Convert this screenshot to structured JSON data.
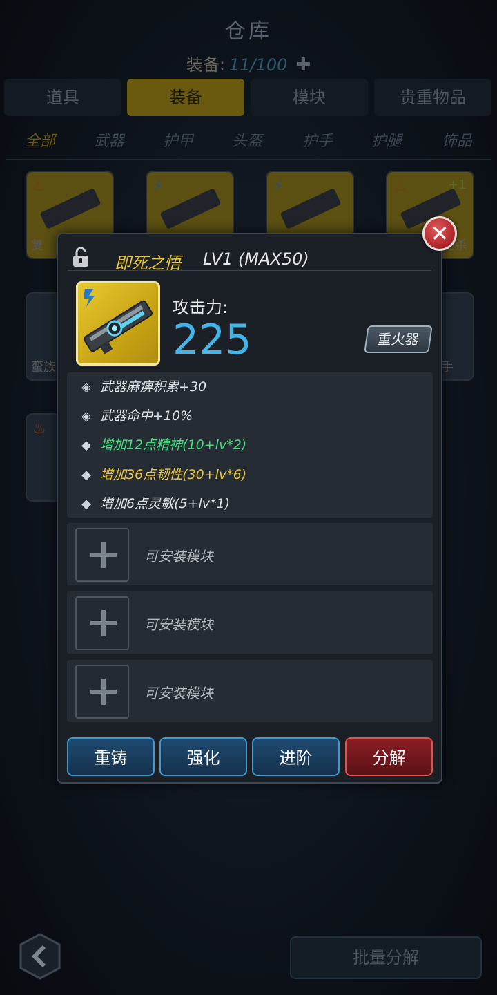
{
  "header": {
    "title": "仓库",
    "count_label": "装备:",
    "count_value": "11/100"
  },
  "tabs": [
    "道具",
    "装备",
    "模块",
    "贵重物品"
  ],
  "active_tab": 1,
  "subtabs": [
    "全部",
    "武器",
    "护甲",
    "头盔",
    "护手",
    "护腿",
    "饰品"
  ],
  "active_subtab": 0,
  "grid_labels": {
    "card1": "复",
    "card4_level": "+1",
    "card4_label": "绝杀",
    "card5": "蛮族",
    "card6": "手"
  },
  "item": {
    "name": "即死之悟",
    "level": "LV1 (MAX50)",
    "attack_label": "攻击力:",
    "attack_value": "225",
    "class": "重火器",
    "stats": [
      {
        "text": "武器麻痹积累+30",
        "style": "base",
        "icon": "target-diamond-icon"
      },
      {
        "text": "武器命中+10%",
        "style": "base",
        "icon": "target-diamond-icon"
      },
      {
        "text": "增加12点精神(10+lv*2)",
        "style": "green",
        "icon": "diamond-icon"
      },
      {
        "text": "增加36点韧性(30+lv*6)",
        "style": "yellow",
        "icon": "diamond-icon"
      },
      {
        "text": "增加6点灵敏(5+lv*1)",
        "style": "base",
        "icon": "diamond-icon"
      }
    ],
    "module_slots": [
      "可安装模块",
      "可安装模块",
      "可安装模块"
    ]
  },
  "actions": {
    "recast": "重铸",
    "enhance": "强化",
    "advance": "进阶",
    "dismantle": "分解"
  },
  "bottom": {
    "batch_dismantle": "批量分解"
  },
  "colors": {
    "name_gold": "#e8c53a",
    "attack_blue": "#43b4e8",
    "stat_green": "#3fe07a",
    "stat_yellow": "#ecc63a",
    "button_blue": "#3e9ad0",
    "button_red": "#e0524e"
  }
}
